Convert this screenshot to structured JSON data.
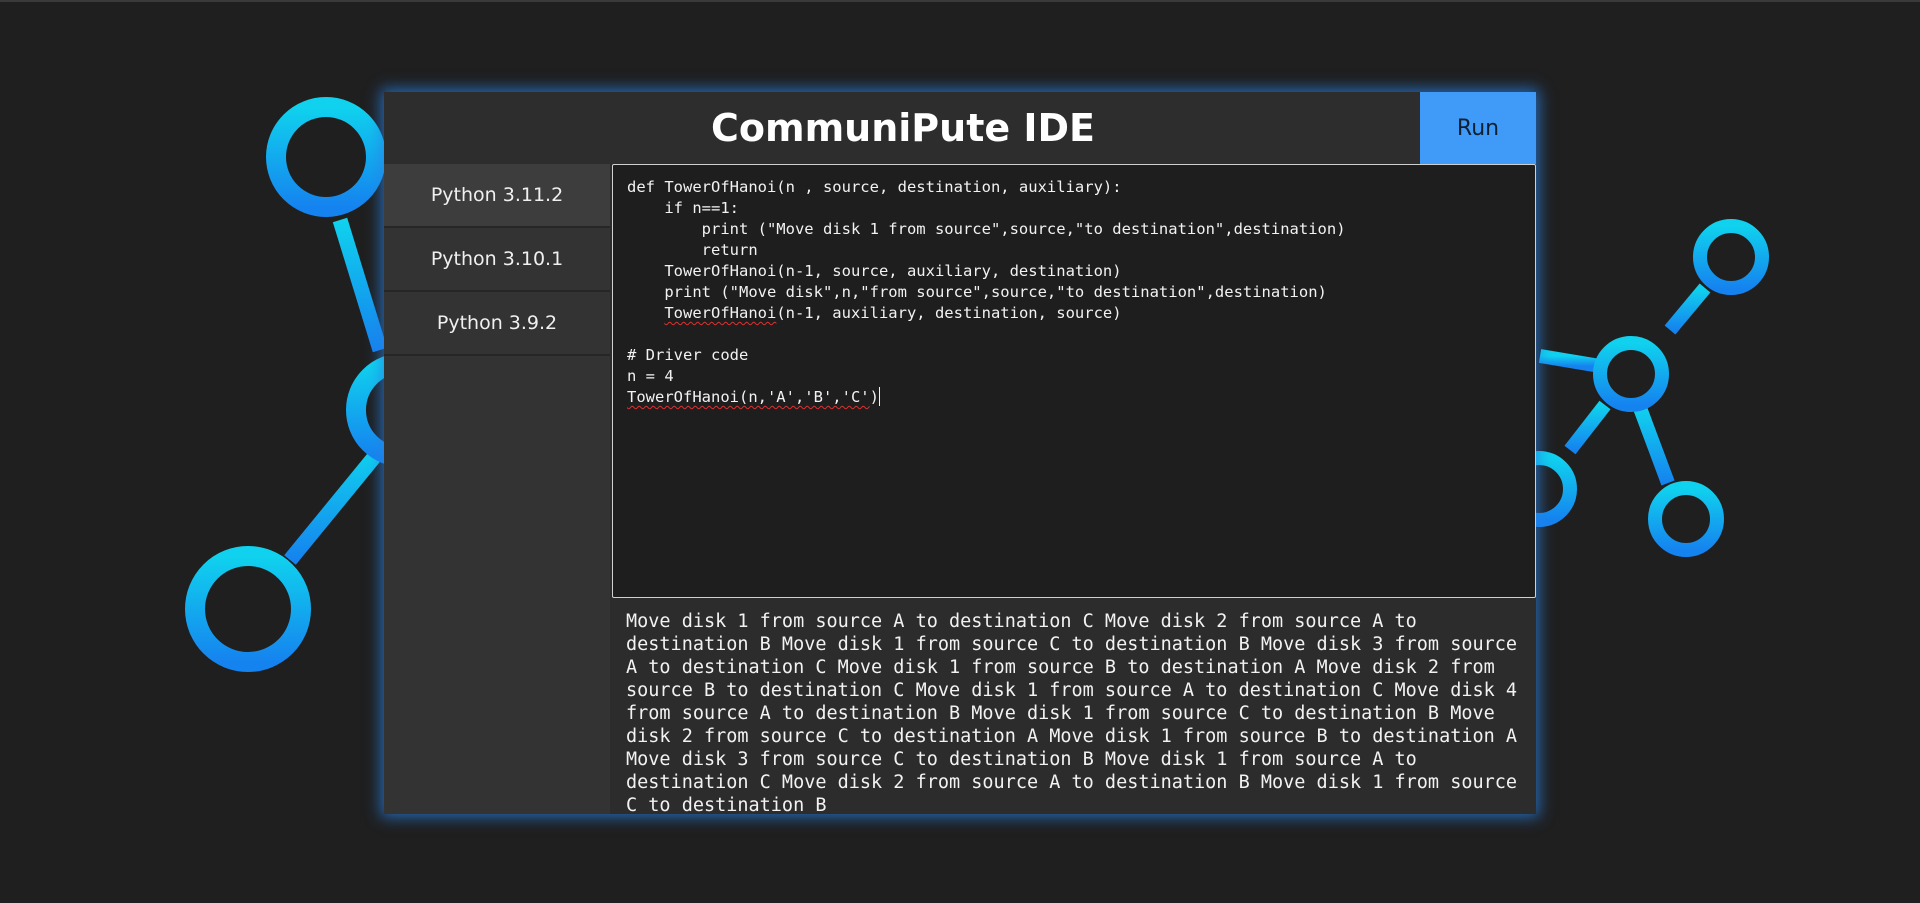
{
  "app": {
    "title": "CommuniPute IDE",
    "run_label": "Run"
  },
  "versions": [
    {
      "label": "Python 3.11.2",
      "active": true
    },
    {
      "label": "Python 3.10.1",
      "active": false
    },
    {
      "label": "Python 3.9.2",
      "active": false
    }
  ],
  "editor": {
    "lines": [
      "def TowerOfHanoi(n , source, destination, auxiliary):",
      "    if n==1:",
      "        print (\"Move disk 1 from source\",source,\"to destination\",destination)",
      "        return",
      "    TowerOfHanoi(n-1, source, auxiliary, destination)",
      "    print (\"Move disk\",n,\"from source\",source,\"to destination\",destination)",
      "    ",
      "",
      "# Driver code",
      "n = 4",
      ""
    ],
    "line7_indent": "    ",
    "line7_call": "TowerOfHanoi",
    "line7_args": "(n-1, auxiliary, destination, source)",
    "last_line_underlined": "TowerOfHanoi(n,'A','B','C'",
    "last_line_rest": ")"
  },
  "output": {
    "text": "Move disk 1 from source A to destination C Move disk 2 from source A to destination B Move disk 1 from source C to destination B Move disk 3 from source A to destination C Move disk 1 from source B to destination A Move disk 2 from source B to destination C Move disk 1 from source A to destination C Move disk 4 from source A to destination B Move disk 1 from source C to destination B Move disk 2 from source C to destination A Move disk 1 from source B to destination A Move disk 3 from source C to destination B Move disk 1 from source A to destination C Move disk 2 from source A to destination B Move disk 1 from source C to destination B"
  },
  "colors": {
    "accent": "#3f9bf7",
    "background": "#1f1f1f",
    "panel": "#2c2c2c",
    "glow": "#2882e6"
  }
}
